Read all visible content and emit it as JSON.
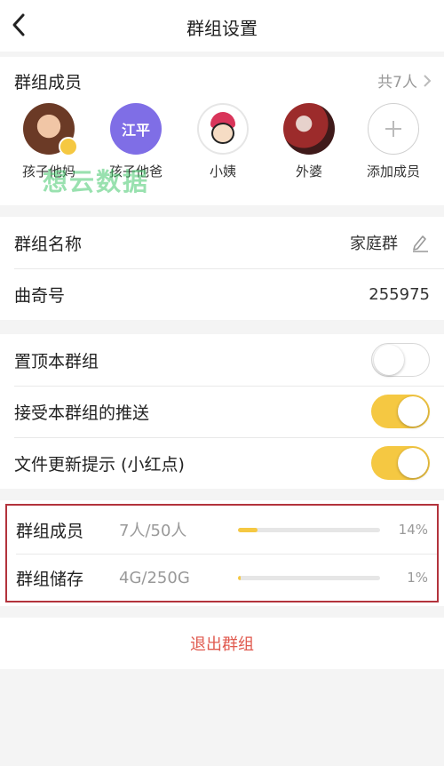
{
  "nav": {
    "title": "群组设置"
  },
  "members": {
    "title": "群组成员",
    "count_text": "共7人",
    "list": [
      {
        "name": "孩子他妈"
      },
      {
        "name": "孩子他爸",
        "avatar_text": "江平"
      },
      {
        "name": "小姨"
      },
      {
        "name": "外婆"
      },
      {
        "name": "添加成员"
      }
    ]
  },
  "info": {
    "group_name_label": "群组名称",
    "group_name_value": "家庭群",
    "qiqi_label": "曲奇号",
    "qiqi_value": "255975"
  },
  "settings": {
    "pin_label": "置顶本群组",
    "pin_on": false,
    "push_label": "接受本群组的推送",
    "push_on": true,
    "reddot_label": "文件更新提示 (小红点)",
    "reddot_on": true
  },
  "stats": {
    "members_label": "群组成员",
    "members_value": "7人/50人",
    "members_pct_text": "14%",
    "members_pct": 14,
    "storage_label": "群组储存",
    "storage_value": "4G/250G",
    "storage_pct_text": "1%",
    "storage_pct": 1
  },
  "actions": {
    "exit_label": "退出群组"
  },
  "watermark": "想云数据",
  "colors": {
    "accent": "#f5c842",
    "danger": "#e05a4f",
    "highlight_border": "#b3333c",
    "avatar_purple": "#7f6ee6"
  }
}
